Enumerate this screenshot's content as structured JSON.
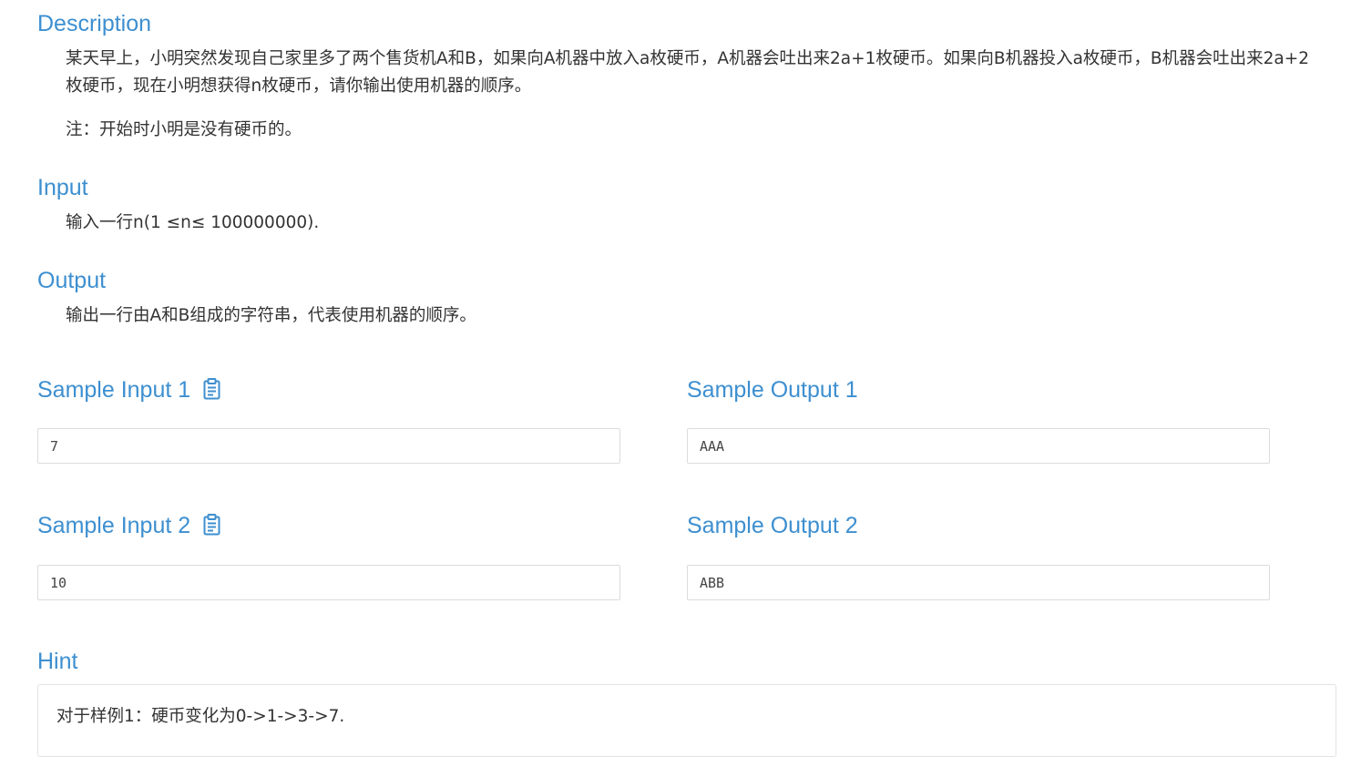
{
  "description": {
    "title": "Description",
    "paragraph1": "某天早上，小明突然发现自己家里多了两个售货机A和B，如果向A机器中放入a枚硬币，A机器会吐出来2a+1枚硬币。如果向B机器投入a枚硬币，B机器会吐出来2a+2枚硬币，现在小明想获得n枚硬币，请你输出使用机器的顺序。",
    "paragraph2": "注：开始时小明是没有硬币的。"
  },
  "input": {
    "title": "Input",
    "text": "输入一行n(1 ≤n≤ 100000000)."
  },
  "output": {
    "title": "Output",
    "text": "输出一行由A和B组成的字符串，代表使用机器的顺序。"
  },
  "samples": [
    {
      "input_title": "Sample Input 1",
      "input_value": "7",
      "output_title": "Sample Output 1",
      "output_value": "AAA",
      "copy_icon": "clipboard-icon"
    },
    {
      "input_title": "Sample Input 2",
      "input_value": "10",
      "output_title": "Sample Output 2",
      "output_value": "ABB",
      "copy_icon": "clipboard-icon"
    }
  ],
  "hint": {
    "title": "Hint",
    "text": "对于样例1：硬币变化为0->1->3->7."
  },
  "colors": {
    "heading": "#3d8fd0",
    "body_text": "#333333",
    "box_border": "#dcdcdc"
  }
}
